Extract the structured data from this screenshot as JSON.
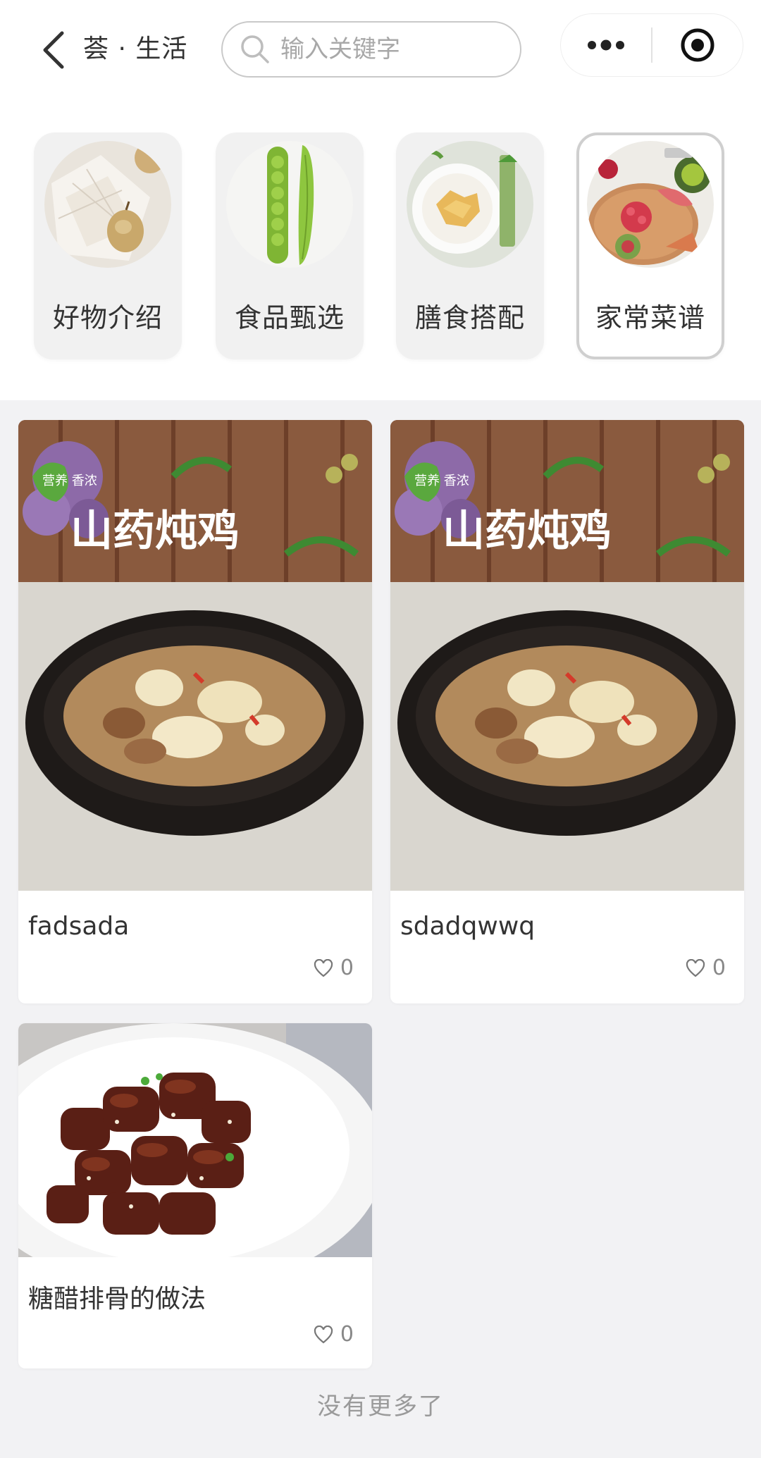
{
  "header": {
    "title": "荟 · 生活",
    "search_placeholder": "输入关键字",
    "back_icon": "chevron-left-icon",
    "more_icon": "more-dots-icon",
    "close_icon": "target-circle-icon"
  },
  "categories": [
    {
      "label": "好物介绍",
      "icon": "pear-photo",
      "active": false
    },
    {
      "label": "食品甄选",
      "icon": "peas-photo",
      "active": false
    },
    {
      "label": "膳食搭配",
      "icon": "dish-photo",
      "active": false
    },
    {
      "label": "家常菜谱",
      "icon": "fruit-platter-photo",
      "active": true
    }
  ],
  "cards": [
    {
      "title": "fadsada",
      "likes": "0",
      "image": "chicken-yam-stew",
      "image_text": "山药炖鸡",
      "badge_text": "营养 香浓"
    },
    {
      "title": "sdadqwwq",
      "likes": "0",
      "image": "chicken-yam-stew",
      "image_text": "山药炖鸡",
      "badge_text": "营养 香浓"
    },
    {
      "title": "糖醋排骨的做法",
      "likes": "0",
      "image": "sweet-sour-ribs"
    }
  ],
  "footer": {
    "no_more": "没有更多了"
  },
  "colors": {
    "background": "#f2f2f4",
    "card": "#ffffff",
    "active_border": "#cfcfcf"
  }
}
